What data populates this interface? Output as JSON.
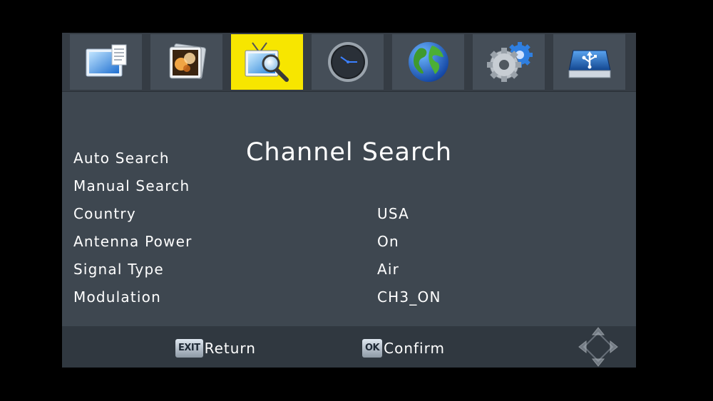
{
  "tabs": [
    {
      "icon": "program-list-icon"
    },
    {
      "icon": "picture-icon"
    },
    {
      "icon": "channel-search-icon",
      "active": true
    },
    {
      "icon": "clock-icon"
    },
    {
      "icon": "globe-icon"
    },
    {
      "icon": "settings-gears-icon"
    },
    {
      "icon": "usb-drive-icon"
    }
  ],
  "page_title": "Channel Search",
  "menu": {
    "auto_search": {
      "label": "Auto Search"
    },
    "manual_search": {
      "label": "Manual Search"
    },
    "country": {
      "label": "Country",
      "value": "USA"
    },
    "antenna_power": {
      "label": "Antenna Power",
      "value": "On"
    },
    "signal_type": {
      "label": "Signal Type",
      "value": "Air"
    },
    "modulation": {
      "label": "Modulation",
      "value": "CH3_ON"
    }
  },
  "footer": {
    "exit_key": "EXIT",
    "exit_label": "Return",
    "ok_key": "OK",
    "ok_label": "Confirm"
  },
  "colors": {
    "panel": "#3e4750",
    "active_tab": "#f7e600",
    "text": "#ffffff"
  }
}
